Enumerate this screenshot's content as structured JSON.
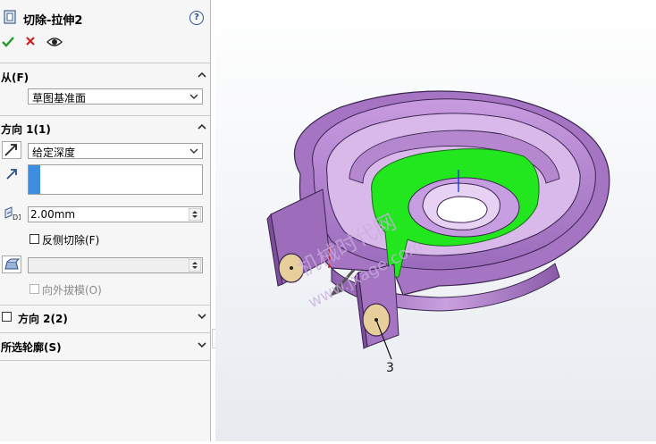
{
  "panel": {
    "title": "切除-拉伸2",
    "help_icon": "help-icon",
    "from": {
      "title": "从(F)",
      "start_condition": "草图基准面"
    },
    "direction1": {
      "title": "方向 1(1)",
      "end_condition": "给定深度",
      "depth": "2.00mm",
      "flip_side_label": "反侧切除(F)",
      "draft_outward_label": "向外拔模(O)"
    },
    "direction2": {
      "title": "方向 2(2)"
    },
    "selected_contours": {
      "title": "所选轮廓(S)"
    }
  },
  "viewport": {
    "callout_label": "3",
    "watermark_line1": "机械时代网",
    "watermark_line2": "www.jxage.com"
  },
  "colors": {
    "cut_face": "#22e61e",
    "body": "#b07fc9",
    "body_dark": "#7d4f9a",
    "selection": "#3d8de0",
    "accent_ok": "#1f9a2a",
    "accent_cancel": "#d02020"
  }
}
